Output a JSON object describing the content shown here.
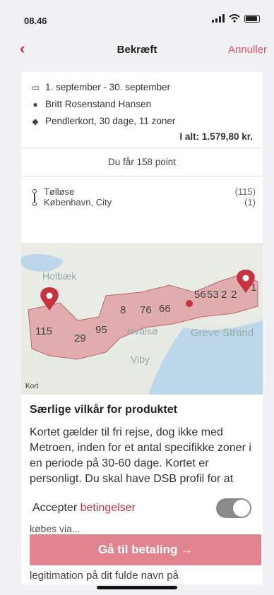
{
  "status_bar": {
    "time": "08.46"
  },
  "nav": {
    "back_icon": "chevron-left-icon",
    "title": "Bekræft",
    "cancel_label": "Annuller"
  },
  "order": {
    "period": "1. september - 30. september",
    "person": "Britt Rosenstand Hansen",
    "product": "Pendlerkort, 30 dage, 11 zoner",
    "total": "I alt: 1.579,80 kr.",
    "points": "Du får 158 point",
    "route": {
      "from": "Tølløse",
      "to": "København, City",
      "from_zone": "(115)",
      "to_zone": "(1)"
    }
  },
  "map": {
    "place_labels": [
      "Holbæk",
      "Hvalsø",
      "Viby",
      "Greve Strand"
    ],
    "zone_labels": [
      "115",
      "29",
      "95",
      "8",
      "76",
      "66",
      "56",
      "53",
      "2",
      "2",
      "1"
    ],
    "attribution": "Kort",
    "highlight_color": "#e0a6a8",
    "pin_color": "#c8323f"
  },
  "terms": {
    "heading": "Særlige vilkår for produktet",
    "body": "Kortet gælder til fri rejse, dog ikke med Metroen, inden for et antal specifikke zoner i en periode på 30-60 dage. Kortet er personligt. Du skal have DSB profil for at"
  },
  "accept": {
    "label": "Accepter ",
    "link": "betingelser",
    "toggle_on": false
  },
  "payment": {
    "button_label": "Gå til betaling →",
    "partial_line": "købes via...",
    "footer_text": "legitimation på dit fulde navn på"
  }
}
